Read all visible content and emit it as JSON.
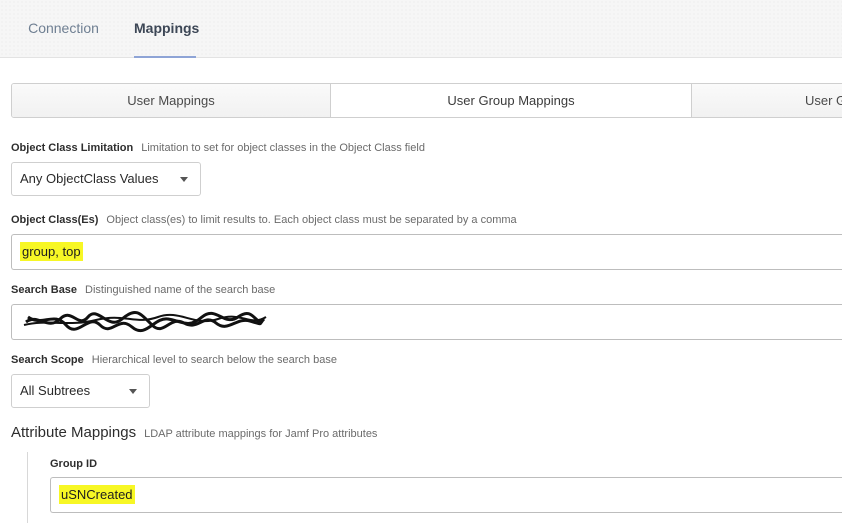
{
  "top_tabs": [
    {
      "label": "Connection",
      "active": false
    },
    {
      "label": "Mappings",
      "active": true
    }
  ],
  "sub_tabs": [
    {
      "label": "User Mappings",
      "active": false
    },
    {
      "label": "User Group Mappings",
      "active": true
    },
    {
      "label": "User G",
      "active": false
    }
  ],
  "fields": {
    "object_class_limitation": {
      "label": "Object Class Limitation",
      "description": "Limitation to set for object classes in the Object Class field",
      "value": "Any ObjectClass Values"
    },
    "object_classes": {
      "label": "Object Class(Es)",
      "description": "Object class(es) to limit results to. Each object class must be separated by a comma",
      "value": "group, top"
    },
    "search_base": {
      "label": "Search Base",
      "description": "Distinguished name of the search base"
    },
    "search_scope": {
      "label": "Search Scope",
      "description": "Hierarchical level to search below the search base",
      "value": "All Subtrees"
    }
  },
  "attribute_mappings": {
    "title": "Attribute Mappings",
    "description": "LDAP attribute mappings for Jamf Pro attributes",
    "group_id": {
      "label": "Group ID",
      "value": "uSNCreated"
    }
  },
  "colors": {
    "highlight": "#f7f725",
    "active_tab_underline": "#8ea4d6"
  },
  "icons": {
    "dropdown": "caret-down-icon"
  }
}
